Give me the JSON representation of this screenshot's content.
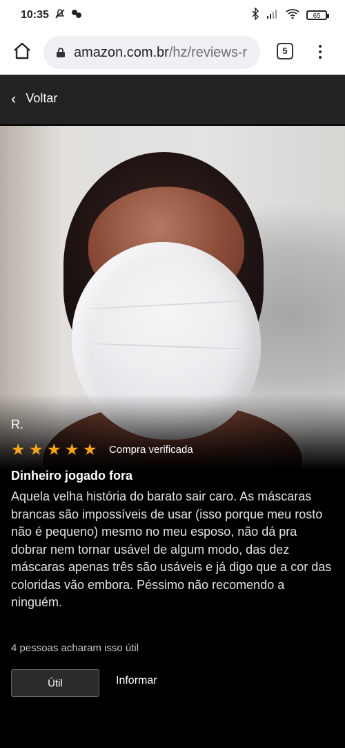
{
  "status": {
    "time": "10:35",
    "battery": "65"
  },
  "browser": {
    "url_domain": "amazon.com.br",
    "url_path": "/hz/reviews-r",
    "tab_count": "5"
  },
  "nav": {
    "back_label": "Voltar"
  },
  "review": {
    "reviewer_name": "R.",
    "rating": 5,
    "max_rating": 5,
    "verified_label": "Compra verificada",
    "title": "Dinheiro jogado fora",
    "body": "Aquela velha história do barato sair caro. As máscaras brancas são impossíveis de usar (isso porque meu rosto não é pequeno) mesmo no meu esposo, não dá pra dobrar nem tornar usável de algum modo, das dez máscaras apenas três são usáveis e já digo que a cor das coloridas vão embora. Péssimo não recomendo a ninguém.",
    "helpful_text": "4 pessoas acharam isso útil",
    "helpful_button_label": "Útil",
    "report_label": "Informar"
  },
  "colors": {
    "star": "#f4a51c",
    "nav_bg": "#232323",
    "page_bg": "#000000"
  }
}
